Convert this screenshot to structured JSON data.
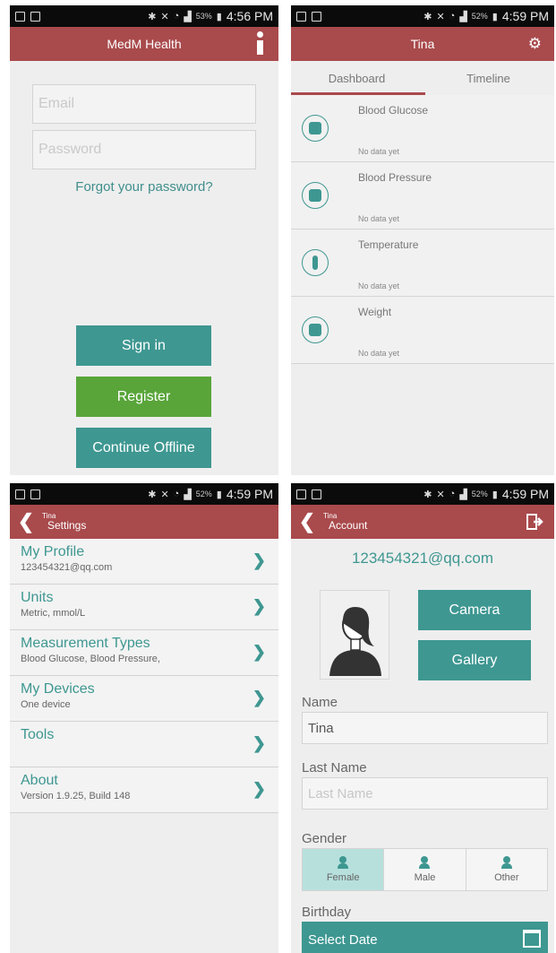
{
  "status": {
    "p1": {
      "time": "4:56 PM",
      "battery": "53%"
    },
    "p2": {
      "time": "4:59 PM",
      "battery": "52%"
    },
    "p3": {
      "time": "4:59 PM",
      "battery": "52%"
    },
    "p4": {
      "time": "4:59 PM",
      "battery": "52%"
    }
  },
  "login": {
    "title": "MedM Health",
    "email_placeholder": "Email",
    "password_placeholder": "Password",
    "forgot": "Forgot your password?",
    "sign_in": "Sign in",
    "register": "Register",
    "offline": "Continue Offline"
  },
  "dashboard": {
    "title": "Tina",
    "tabs": [
      "Dashboard",
      "Timeline"
    ],
    "items": [
      {
        "name": "Blood Glucose",
        "status": "No data yet",
        "icon": "glucose-meter-icon"
      },
      {
        "name": "Blood Pressure",
        "status": "No data yet",
        "icon": "blood-pressure-icon"
      },
      {
        "name": "Temperature",
        "status": "No data yet",
        "icon": "thermometer-icon"
      },
      {
        "name": "Weight",
        "status": "No data yet",
        "icon": "scale-icon"
      }
    ]
  },
  "settings": {
    "user": "Tina",
    "title": "Settings",
    "items": [
      {
        "title": "My Profile",
        "sub": "123454321@qq.com"
      },
      {
        "title": "Units",
        "sub": "Metric, mmol/L"
      },
      {
        "title": "Measurement Types",
        "sub": "Blood Glucose, Blood Pressure,"
      },
      {
        "title": "My Devices",
        "sub": "One device"
      },
      {
        "title": "Tools",
        "sub": ""
      },
      {
        "title": "About",
        "sub": "Version 1.9.25, Build 148"
      }
    ]
  },
  "account": {
    "user": "Tina",
    "title": "Account",
    "email": "123454321@qq.com",
    "camera": "Camera",
    "gallery": "Gallery",
    "name_label": "Name",
    "name_value": "Tina",
    "last_name_label": "Last Name",
    "last_name_placeholder": "Last Name",
    "gender_label": "Gender",
    "genders": [
      "Female",
      "Male",
      "Other"
    ],
    "birthday_label": "Birthday",
    "select_date": "Select Date"
  },
  "colors": {
    "accent": "#a94a4c",
    "teal": "#3e9791",
    "green": "#59a53a"
  }
}
